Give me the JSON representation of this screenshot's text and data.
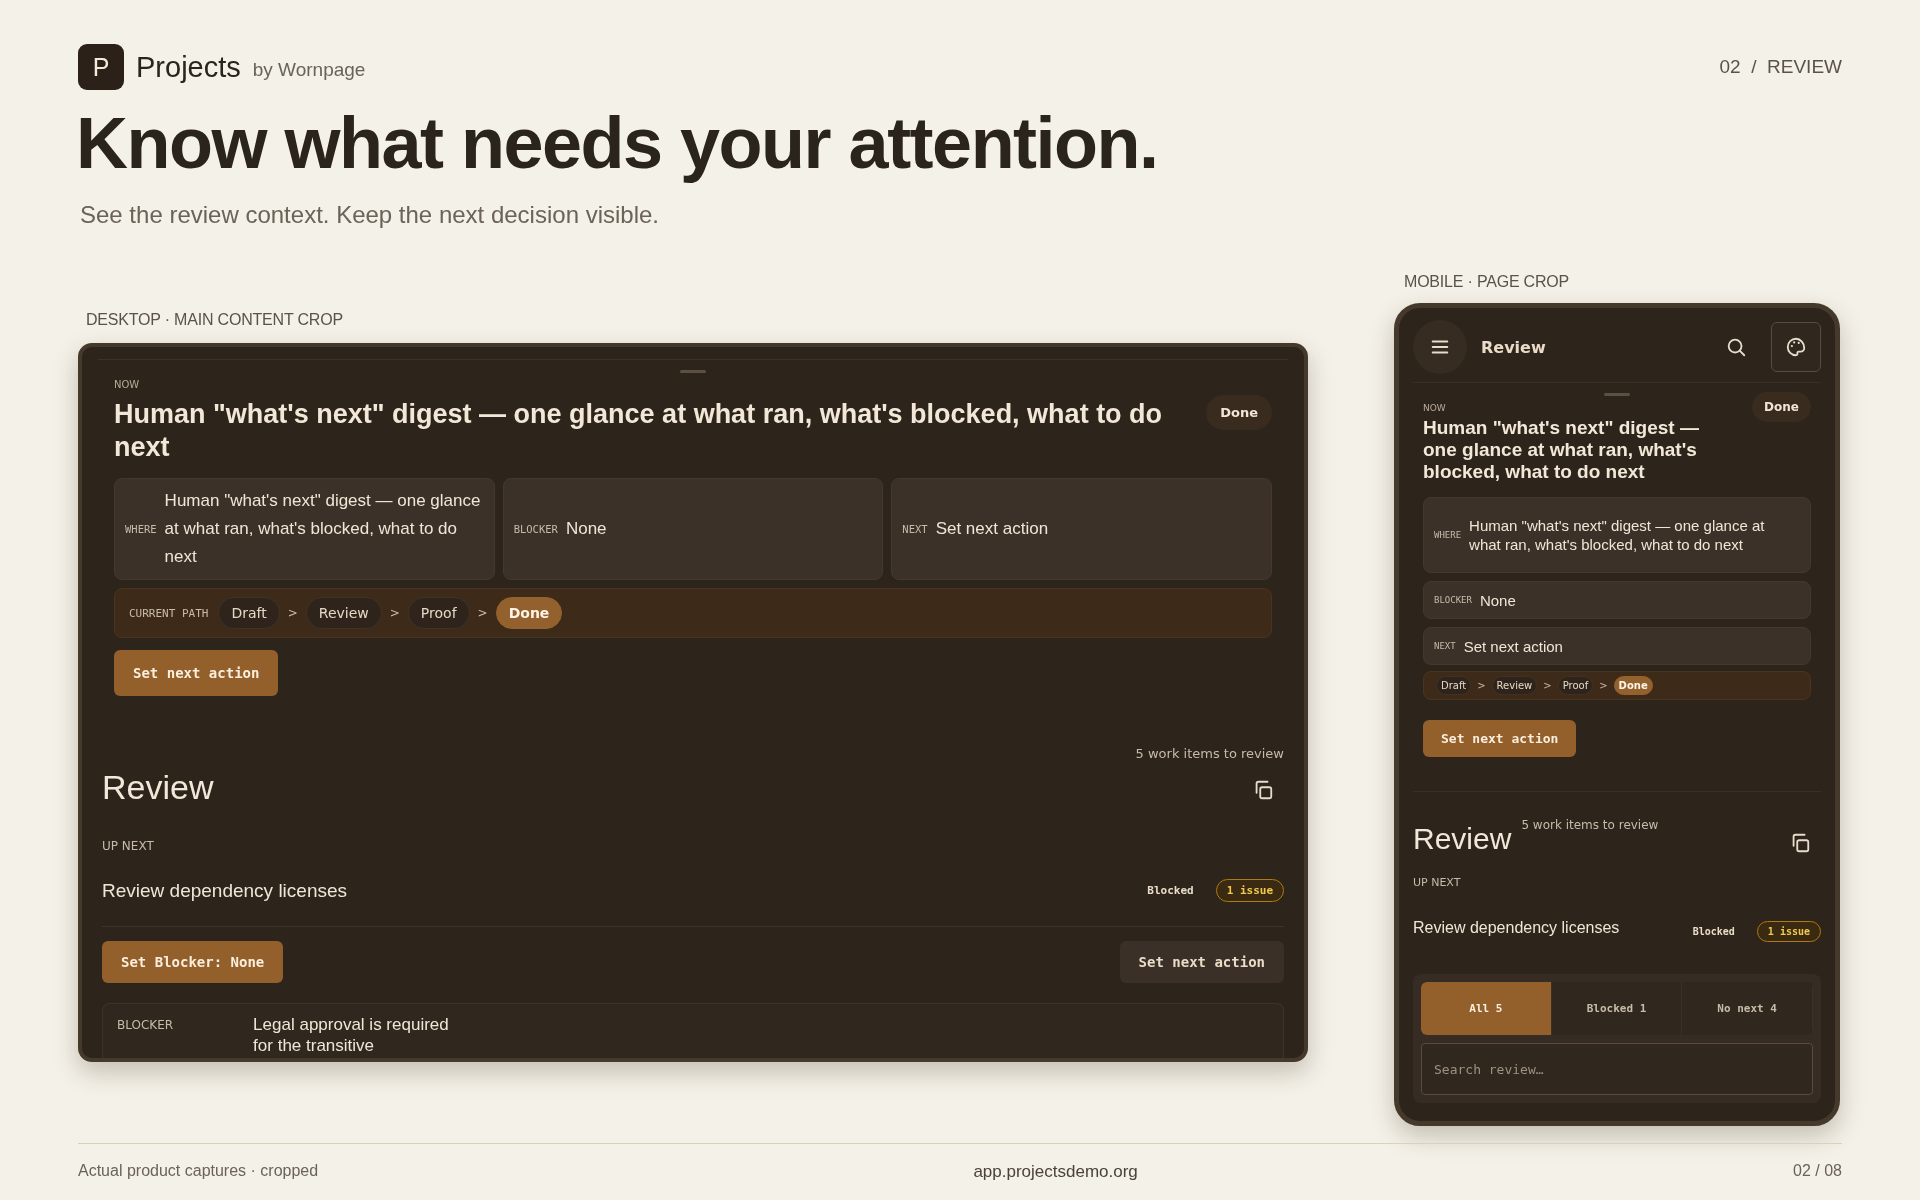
{
  "brand": {
    "logo": "P",
    "name": "Projects",
    "byline": "by Wornpage"
  },
  "page_marker": {
    "number": "02",
    "separator": "/",
    "section": "REVIEW"
  },
  "headline": "Know what needs your attention.",
  "subtitle": "See the review context. Keep the next decision visible.",
  "desktop": {
    "caption": "DESKTOP · MAIN CONTENT CROP",
    "now": {
      "label": "NOW",
      "title": "Human \"what's next\" digest — one glance at what ran, what's blocked, what to do next",
      "status": "Done",
      "facts": [
        {
          "label": "WHERE",
          "value": "Human \"what's next\" digest — one glance at what ran, what's blocked, what to do next"
        },
        {
          "label": "BLOCKER",
          "value": "None"
        },
        {
          "label": "NEXT",
          "value": "Set next action"
        }
      ],
      "path": {
        "label": "CURRENT PATH",
        "steps": [
          {
            "label": "Draft",
            "selected": false
          },
          {
            "separator": ">",
            "label": "Review",
            "selected": false
          },
          {
            "separator": ">",
            "label": "Proof",
            "selected": false
          },
          {
            "separator": ">",
            "label": "Done",
            "selected": true
          }
        ]
      },
      "action": "Set next action"
    },
    "review": {
      "count": "5 work items to review",
      "title": "Review",
      "section_label": "UP NEXT",
      "item": {
        "title": "Review dependency licenses",
        "status": "Blocked",
        "badge": "1 issue"
      },
      "actions": [
        {
          "label": "Set Blocker: None",
          "kind": "primary"
        },
        {
          "label": "Set next action",
          "kind": "secondary"
        }
      ],
      "detail": {
        "label": "BLOCKER",
        "value": "Legal approval is required for the transitive"
      }
    }
  },
  "mobile": {
    "caption": "MOBILE · PAGE CROP",
    "topbar": {
      "title": "Review"
    },
    "now": {
      "label": "NOW",
      "title": "Human \"what's next\" digest — one glance at what ran, what's blocked, what to do next",
      "status": "Done",
      "facts": [
        {
          "label": "WHERE",
          "value": "Human \"what's next\" digest — one glance at what ran, what's blocked, what to do next"
        },
        {
          "label": "BLOCKER",
          "value": "None"
        },
        {
          "label": "NEXT",
          "value": "Set next action"
        }
      ],
      "path": {
        "steps": [
          {
            "label": "Draft",
            "selected": false
          },
          {
            "separator": ">",
            "label": "Review",
            "selected": false
          },
          {
            "separator": ">",
            "label": "Proof",
            "selected": false
          },
          {
            "separator": ">",
            "label": "Done",
            "selected": true
          }
        ]
      },
      "action": "Set next action"
    },
    "review": {
      "count": "5 work items to review",
      "title": "Review",
      "section_label": "UP NEXT",
      "item": {
        "title": "Review dependency licenses",
        "status": "Blocked",
        "badge": "1 issue"
      },
      "filters": [
        {
          "label": "All 5",
          "selected": true
        },
        {
          "label": "Blocked 1",
          "selected": false
        },
        {
          "label": "No next 4",
          "selected": false
        }
      ],
      "search": {
        "placeholder": "Search review…"
      }
    }
  },
  "footer": {
    "note": "Actual product captures · cropped",
    "url": "app.projectsdemo.org",
    "page": "02 / 08"
  }
}
